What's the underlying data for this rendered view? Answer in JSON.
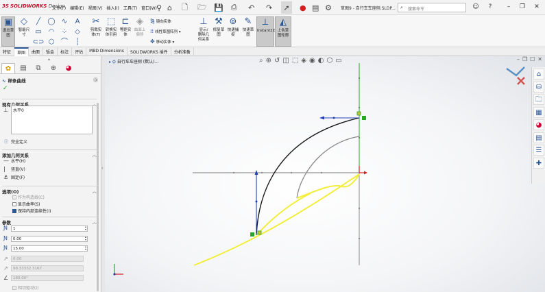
{
  "app": {
    "logo_brand": "3S",
    "logo_name": "SOLIDWORKS",
    "logo_suffix": "Design",
    "document_title": "草图9 - 自行车车座侧.SLDP...",
    "search_placeholder": "搜索命令"
  },
  "menu": [
    "文件(F)",
    "编辑(E)",
    "视图(V)",
    "插入(I)",
    "工具(T)",
    "窗口(W)"
  ],
  "ribbon": {
    "exit_sketch": "退出草\n图",
    "smart_dimension": "智能尺\n寸",
    "mirror_entities": "镜向实体",
    "linear_pattern": "线性草图阵列",
    "move_entities": "移动实体",
    "trim_entities": "剪裁实\n体(T)",
    "convert_entities": "转换实\n体引用",
    "offset_entities": "等距实\n体",
    "surface_offset": "曲面上\n偏移",
    "display_relations": "显示/\n删除几\n何关系",
    "repair_sketch": "修复草\n图",
    "quick_snaps": "快速捕\n捉",
    "rapid_sketch": "快速草\n图",
    "instant2d": "Instant2D",
    "shaded_contours": "上色草\n图轮廓"
  },
  "tabs": [
    "特征",
    "草图",
    "曲面",
    "钣金",
    "标注",
    "评估",
    "MBD Dimensions",
    "SOLIDWORKS 插件",
    "分析准备"
  ],
  "active_tab_index": 1,
  "property_manager": {
    "title": "样条曲线",
    "existing_relations": {
      "header": "现有几何关系",
      "items": [
        "水平0"
      ]
    },
    "status": "完全定义",
    "add_relations": {
      "header": "添加几何关系",
      "items": [
        "水平(H)",
        "竖直(V)",
        "固定(F)"
      ]
    },
    "options": {
      "header": "选项(O)",
      "items": [
        {
          "label": "作为构造线(C)",
          "checked": false,
          "disabled": true
        },
        {
          "label": "显示曲率(S)",
          "checked": false,
          "disabled": false
        },
        {
          "label": "保持内部连续性(I)",
          "checked": true,
          "disabled": false
        }
      ]
    },
    "parameters": {
      "header": "参数",
      "point_index": "1",
      "x_coord": "0.00",
      "y_coord": "15.00",
      "weight": "0.00",
      "tangent_radial": "98.33332 3167",
      "tangent_angle": "180.00°",
      "tangent_driving": "相切驱动(I)"
    }
  },
  "graphics": {
    "tree_flyout": "自行车车座侧 (默认)..."
  },
  "colors": {
    "accent": "#2b5797",
    "sketch_black": "#1a1a1a",
    "sketch_blue": "#1f3fb5",
    "construction_gray": "#8a8a8a",
    "highlight_yellow": "#f2ee3a",
    "relation_green": "#2aa52a",
    "origin_red": "#d21f1f"
  }
}
